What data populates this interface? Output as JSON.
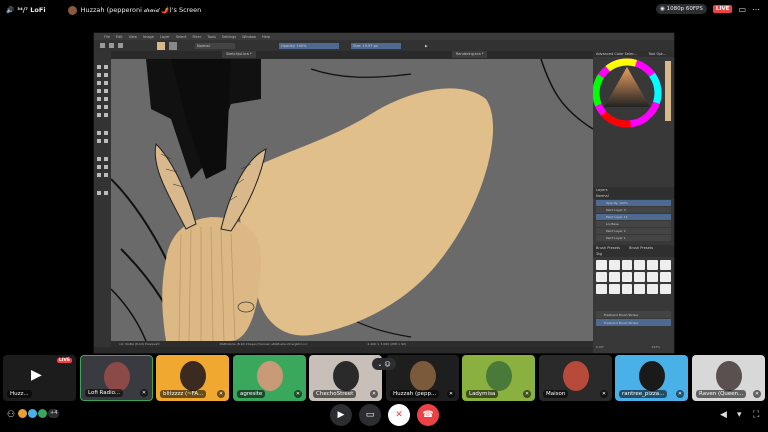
{
  "header": {
    "channel_name": "³⁴/⁷ LoFi",
    "stream_title": "Huzzah (pepperoni 𝒹𝓇𝓊𝒾𝒹 🌶️)'s Screen",
    "quality": "1080p 60FPS",
    "live": "LIVE"
  },
  "krita": {
    "menu": [
      "File",
      "Edit",
      "View",
      "Image",
      "Layer",
      "Select",
      "Filter",
      "Tools",
      "Settings",
      "Window",
      "Help"
    ],
    "brush_label": "Normal",
    "opacity": "Opacity: 100%",
    "size": "Size: 19.97 px",
    "doc_tab": "SketchJul.kra *",
    "doc_tab2": "Rendering.kra *",
    "status_left": "xxl: RGBA (8-bit)  Pixelpaint",
    "status_mid": "RGB/Alpha (8-bit integer/channel)  sRGB-elle-V2-srgbtrc.icc",
    "status_right": "2,400 × 3,000 (288 × 90)",
    "zoom_left": "0.00°",
    "zoom_right": "193%",
    "color_panel": "Advanced Color Selec...",
    "tool_options": "Tool Opt...",
    "layers_title": "Layers",
    "layers_mode": "Normal",
    "layers_opacity": "Opacity: 100%",
    "layers": [
      "Paint Layer 3",
      "Paint Layer 11",
      "Lrs Base",
      "Paint Layer 2",
      "Paint Layer 1"
    ],
    "brush_presets_title": "Brush Presets",
    "brush_presets_tab": "Brush Presets",
    "tag": "Tag",
    "presets": [
      "Freehand Brush Stroke",
      "Freehand Brush Stroke"
    ]
  },
  "participants": [
    {
      "name": "Huzz...",
      "mic": "⋯",
      "live": "LIVE"
    },
    {
      "name": "Lofi Radio...",
      "mic": "✕"
    },
    {
      "name": "blitzzzz (~FA...",
      "mic": "✕"
    },
    {
      "name": "agresite",
      "mic": "✕"
    },
    {
      "name": "ChechoStreet",
      "mic": "✕"
    },
    {
      "name": "Huzzah (pepp...",
      "mic": "✕"
    },
    {
      "name": "Ladymisa",
      "mic": "✕"
    },
    {
      "name": "Maison",
      "mic": "✕"
    },
    {
      "name": "rantree_pizza...",
      "mic": "✕"
    },
    {
      "name": "Raven (Queen...",
      "mic": "✕"
    }
  ],
  "controls": {
    "participant_count": "+4"
  },
  "colors": {
    "accent_live": "#ed4245",
    "canvas_gray": "#6a6a6a",
    "skin_tone": "#e0bf8a"
  }
}
